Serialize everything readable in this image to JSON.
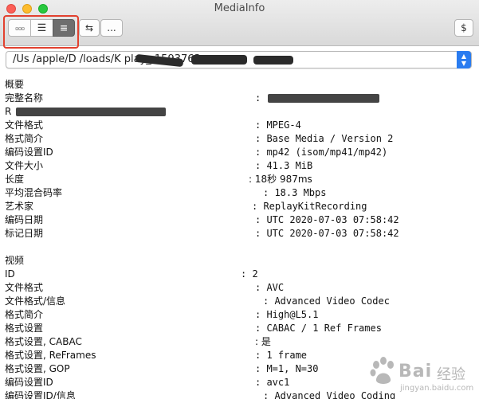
{
  "window": {
    "title": "MediaInfo"
  },
  "toolbar": {
    "views": [
      {
        "label": "▫▫▫",
        "name": "basic-view-button"
      },
      {
        "label": "☰",
        "name": "tree-view-button"
      },
      {
        "label": "≡",
        "name": "text-view-button",
        "active": true
      }
    ],
    "swap_label": "⇆",
    "more_label": "...",
    "dollar_label": "$"
  },
  "file": {
    "path_visible": "/Us  /apple/D  /loads/K  play_  1593763"
  },
  "sections": [
    {
      "header": "概要",
      "rows": [
        {
          "key": "完整名称",
          "value": ": "
        },
        {
          "key": "R",
          "value": ""
        },
        {
          "key": "文件格式",
          "value": ": MPEG-4"
        },
        {
          "key": "格式简介",
          "value": ": Base Media / Version 2"
        },
        {
          "key": "编码设置ID",
          "value": ": mp42 (isom/mp41/mp42)"
        },
        {
          "key": "文件大小",
          "value": ": 41.3 MiB"
        },
        {
          "key": "长度",
          "value": ": 18秒 987ms"
        },
        {
          "key": "平均混合码率",
          "value": ": 18.3 Mbps"
        },
        {
          "key": "艺术家",
          "value": ": ReplayKitRecording"
        },
        {
          "key": "编码日期",
          "value": ": UTC 2020-07-03 07:58:42"
        },
        {
          "key": "标记日期",
          "value": ": UTC 2020-07-03 07:58:42"
        }
      ]
    },
    {
      "header": "视频",
      "rows": [
        {
          "key": "ID",
          "value": ": 2"
        },
        {
          "key": "文件格式",
          "value": ": AVC"
        },
        {
          "key": "文件格式/信息",
          "value": ": Advanced Video Codec"
        },
        {
          "key": "格式简介",
          "value": ": High@L5.1"
        },
        {
          "key": "格式设置",
          "value": ": CABAC / 1 Ref Frames"
        },
        {
          "key": "格式设置, CABAC",
          "value": ": 是"
        },
        {
          "key": "格式设置, ReFrames",
          "value": ": 1 frame"
        },
        {
          "key": "格式设置, GOP",
          "value": ": M=1, N=30"
        },
        {
          "key": "编码设置ID",
          "value": ": avc1"
        },
        {
          "key": "编码设置ID/信息",
          "value": ": Advanced Video Coding"
        }
      ]
    }
  ],
  "watermark": {
    "brand": "Bai",
    "brand_cn": "经验",
    "url": "jingyan.baidu.com"
  }
}
